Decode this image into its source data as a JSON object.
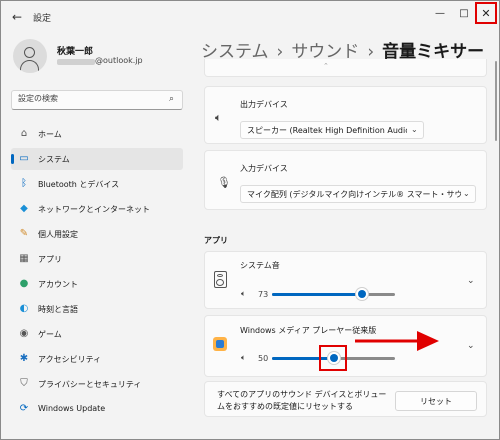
{
  "titlebar": {
    "back_icon": "back-arrow-icon",
    "app_title": "設定",
    "minimize_glyph": "—",
    "maximize_glyph": "□",
    "close_glyph": "✕"
  },
  "user": {
    "name": "秋葉一郎",
    "email_visible": "@outlook.jp"
  },
  "search": {
    "placeholder": "設定の検索",
    "icon": "search-icon"
  },
  "sidebar": {
    "items": [
      {
        "label": "ホーム",
        "icon": "home-icon",
        "glyph": "⌂",
        "active": false
      },
      {
        "label": "システム",
        "icon": "monitor-icon",
        "glyph": "▭",
        "active": true
      },
      {
        "label": "Bluetooth とデバイス",
        "icon": "bluetooth-icon",
        "glyph": "ᛒ",
        "active": false
      },
      {
        "label": "ネットワークとインターネット",
        "icon": "wifi-icon",
        "glyph": "◆",
        "active": false
      },
      {
        "label": "個人用設定",
        "icon": "brush-icon",
        "glyph": "✎",
        "active": false
      },
      {
        "label": "アプリ",
        "icon": "apps-icon",
        "glyph": "▦",
        "active": false
      },
      {
        "label": "アカウント",
        "icon": "account-icon",
        "glyph": "●",
        "active": false
      },
      {
        "label": "時刻と言語",
        "icon": "clock-globe-icon",
        "glyph": "◐",
        "active": false
      },
      {
        "label": "ゲーム",
        "icon": "gamepad-icon",
        "glyph": "◉",
        "active": false
      },
      {
        "label": "アクセシビリティ",
        "icon": "accessibility-icon",
        "glyph": "✱",
        "active": false
      },
      {
        "label": "プライバシーとセキュリティ",
        "icon": "shield-icon",
        "glyph": "⛉",
        "active": false
      },
      {
        "label": "Windows Update",
        "icon": "update-icon",
        "glyph": "⟳",
        "active": false
      }
    ],
    "accent_color": "#0067c0"
  },
  "breadcrumb": {
    "part1": "システム",
    "part2": "サウンド",
    "current": "音量ミキサー",
    "separator": "›"
  },
  "output_device": {
    "title": "出力デバイス",
    "icon": "speaker-icon",
    "value": "スピーカー (Realtek High Definition Audio)"
  },
  "input_device": {
    "title": "入力デバイス",
    "icon": "microphone-icon",
    "value": "マイク配列 (デジタルマイク向けインテル® スマート・サウンド・テ"
  },
  "apps_section": {
    "label": "アプリ",
    "items": [
      {
        "name": "システム音",
        "icon": "system-sounds-icon",
        "volume": 73
      },
      {
        "name": "Windows メディア プレーヤー従来版",
        "icon": "media-player-icon",
        "volume": 50
      }
    ]
  },
  "reset": {
    "text": "すべてのアプリのサウンド デバイスとボリュームをおすすめの既定値にリセットする",
    "button_label": "リセット"
  },
  "colors": {
    "accent": "#0067c0",
    "annotation_red": "#e00000"
  }
}
